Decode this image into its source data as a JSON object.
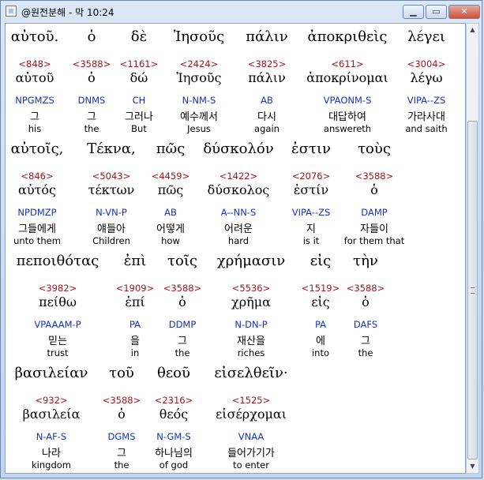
{
  "window": {
    "title": "@원전분해 - 막 10:24",
    "minimize_label": "▁",
    "maximize_label": "▭",
    "close_label": "✕"
  },
  "scrollbar": {
    "up_arrow": "▲",
    "down_arrow": "▼"
  },
  "lines": [
    {
      "words": [
        {
          "greek": "αὐτοῦ.",
          "strong": "<848>",
          "lemma": "αὐτοῦ",
          "morph": "NPGMZS",
          "korean": "그",
          "english": "his"
        },
        {
          "greek": "ὁ",
          "strong": "<3588>",
          "lemma": "ὁ",
          "morph": "DNMS",
          "korean": "그",
          "english": "the"
        },
        {
          "greek": "δὲ",
          "strong": "<1161>",
          "lemma": "δώ",
          "morph": "CH",
          "korean": "그러나",
          "english": "But"
        },
        {
          "greek": "Ἰησοῦς",
          "strong": "<2424>",
          "lemma": "Ἰησοῦς",
          "morph": "N-NM-S",
          "korean": "예수께서",
          "english": "Jesus"
        },
        {
          "greek": "πάλιν",
          "strong": "<3825>",
          "lemma": "πάλιν",
          "morph": "AB",
          "korean": "다시",
          "english": "again"
        },
        {
          "greek": "ἀποκριθεὶς",
          "strong": "<611>",
          "lemma": "ἀποκρίνομαι",
          "morph": "VPAONM-S",
          "korean": "대답하여",
          "english": "answereth"
        },
        {
          "greek": "λέγει",
          "strong": "<3004>",
          "lemma": "λέγω",
          "morph": "VIPA--ZS",
          "korean": "가라사대",
          "english": "and saith"
        }
      ]
    },
    {
      "words": [
        {
          "greek": "αὐτοῖς,",
          "strong": "<846>",
          "lemma": "αὐτός",
          "morph": "NPDMZP",
          "korean": "그들에게",
          "english": "unto them"
        },
        {
          "greek": "Τέκνα,",
          "strong": "<5043>",
          "lemma": "τέκτων",
          "morph": "N-VN-P",
          "korean": "얘들아",
          "english": "Children"
        },
        {
          "greek": "πῶς",
          "strong": "<4459>",
          "lemma": "πῶς",
          "morph": "AB",
          "korean": "어떻게",
          "english": "how"
        },
        {
          "greek": "δύσκολόν",
          "strong": "<1422>",
          "lemma": "δύσκολος",
          "morph": "A--NN-S",
          "korean": "어려운",
          "english": "hard"
        },
        {
          "greek": "ἐστιν",
          "strong": "<2076>",
          "lemma": "ἐστίν",
          "morph": "VIPA--ZS",
          "korean": "지",
          "english": "is it"
        },
        {
          "greek": "τοὺς",
          "strong": "<3588>",
          "lemma": "ὁ",
          "morph": "DAMP",
          "korean": "자들이",
          "english": "for them that"
        }
      ]
    },
    {
      "words": [
        {
          "greek": "πεποιθότας",
          "strong": "<3982>",
          "lemma": "πείθω",
          "morph": "VPAAAM-P",
          "korean": "믿는",
          "english": "trust"
        },
        {
          "greek": "ἐπὶ",
          "strong": "<1909>",
          "lemma": "ἐπί",
          "morph": "PA",
          "korean": "을",
          "english": "in"
        },
        {
          "greek": "τοῖς",
          "strong": "<3588>",
          "lemma": "ὁ",
          "morph": "DDMP",
          "korean": "그",
          "english": "the"
        },
        {
          "greek": "χρήμασιν",
          "strong": "<5536>",
          "lemma": "χρῆμα",
          "morph": "N-DN-P",
          "korean": "재산을",
          "english": "riches"
        },
        {
          "greek": "εἰς",
          "strong": "<1519>",
          "lemma": "εἰς",
          "morph": "PA",
          "korean": "에",
          "english": "into"
        },
        {
          "greek": "τὴν",
          "strong": "<3588>",
          "lemma": "ὁ",
          "morph": "DAFS",
          "korean": "그",
          "english": "the"
        }
      ]
    },
    {
      "words": [
        {
          "greek": "βασιλείαν",
          "strong": "<932>",
          "lemma": "βασιλεία",
          "morph": "N-AF-S",
          "korean": "나라",
          "english": "kingdom"
        },
        {
          "greek": "τοῦ",
          "strong": "<3588>",
          "lemma": "ὁ",
          "morph": "DGMS",
          "korean": "그",
          "english": "the"
        },
        {
          "greek": "θεοῦ",
          "strong": "<2316>",
          "lemma": "θεός",
          "morph": "N-GM-S",
          "korean": "하나님의",
          "english": "of god"
        },
        {
          "greek": "εἰσελθεῖν·",
          "strong": "<1525>",
          "lemma": "εἰσέρχομαι",
          "morph": "VNAA",
          "korean": "들어가기가",
          "english": "to enter"
        }
      ]
    }
  ]
}
